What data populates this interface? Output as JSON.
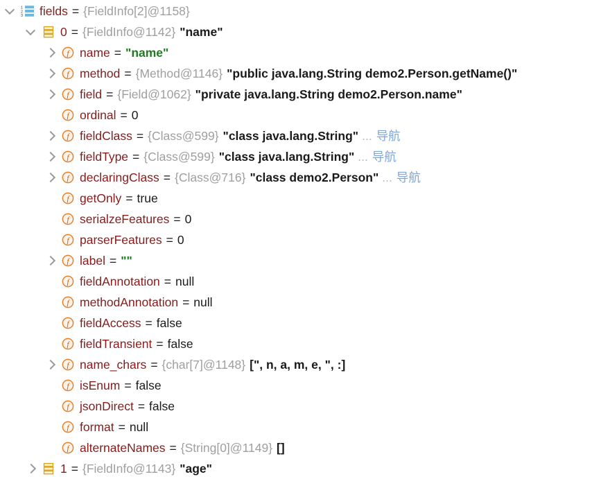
{
  "view": {
    "name": "debugger-variables-tree",
    "background": "#ffffff",
    "colors": {
      "field_name": "#871B1B",
      "type_reference": "#9f9f9f",
      "string_value": "#217C21",
      "plain_value": "#1a1a1a",
      "nav_link": "#7fa8d8",
      "ellipsis": "#b8b8b8",
      "field_icon": "#E8802A",
      "array_icon_blue": "#6BB8DE",
      "array_item_icon": "#D9A01E",
      "twisty": "#9a9a9a"
    }
  },
  "rows": [
    {
      "depth": 0,
      "twisty": "expanded",
      "icon": "array-list-icon",
      "name": "fields",
      "eq": "=",
      "typeref": "{FieldInfo[2]@1158}",
      "value": "",
      "value_kind": "none",
      "ellipsis": "",
      "nav": ""
    },
    {
      "depth": 1,
      "twisty": "expanded",
      "icon": "array-item-icon",
      "name": "0",
      "eq": "=",
      "typeref": "{FieldInfo@1142}",
      "value": "\"name\"",
      "value_kind": "bold",
      "ellipsis": "",
      "nav": ""
    },
    {
      "depth": 2,
      "twisty": "collapsed",
      "icon": "field-icon",
      "name": "name",
      "eq": "=",
      "typeref": "",
      "value": "\"name\"",
      "value_kind": "string",
      "ellipsis": "",
      "nav": ""
    },
    {
      "depth": 2,
      "twisty": "collapsed",
      "icon": "field-icon",
      "name": "method",
      "eq": "=",
      "typeref": "{Method@1146}",
      "value": "\"public java.lang.String demo2.Person.getName()\"",
      "value_kind": "bold",
      "ellipsis": "",
      "nav": ""
    },
    {
      "depth": 2,
      "twisty": "collapsed",
      "icon": "field-icon",
      "name": "field",
      "eq": "=",
      "typeref": "{Field@1062}",
      "value": "\"private java.lang.String demo2.Person.name\"",
      "value_kind": "bold",
      "ellipsis": "",
      "nav": ""
    },
    {
      "depth": 2,
      "twisty": "none",
      "icon": "field-icon",
      "name": "ordinal",
      "eq": "=",
      "typeref": "",
      "value": "0",
      "value_kind": "plain",
      "ellipsis": "",
      "nav": ""
    },
    {
      "depth": 2,
      "twisty": "collapsed",
      "icon": "field-icon",
      "name": "fieldClass",
      "eq": "=",
      "typeref": "{Class@599}",
      "value": "\"class java.lang.String\"",
      "value_kind": "bold",
      "ellipsis": "...",
      "nav": "导航"
    },
    {
      "depth": 2,
      "twisty": "collapsed",
      "icon": "field-icon",
      "name": "fieldType",
      "eq": "=",
      "typeref": "{Class@599}",
      "value": "\"class java.lang.String\"",
      "value_kind": "bold",
      "ellipsis": "...",
      "nav": "导航"
    },
    {
      "depth": 2,
      "twisty": "collapsed",
      "icon": "field-icon",
      "name": "declaringClass",
      "eq": "=",
      "typeref": "{Class@716}",
      "value": "\"class demo2.Person\"",
      "value_kind": "bold",
      "ellipsis": "...",
      "nav": "导航"
    },
    {
      "depth": 2,
      "twisty": "none",
      "icon": "field-icon",
      "name": "getOnly",
      "eq": "=",
      "typeref": "",
      "value": "true",
      "value_kind": "plain",
      "ellipsis": "",
      "nav": ""
    },
    {
      "depth": 2,
      "twisty": "none",
      "icon": "field-icon",
      "name": "serialzeFeatures",
      "eq": "=",
      "typeref": "",
      "value": "0",
      "value_kind": "plain",
      "ellipsis": "",
      "nav": ""
    },
    {
      "depth": 2,
      "twisty": "none",
      "icon": "field-icon",
      "name": "parserFeatures",
      "eq": "=",
      "typeref": "",
      "value": "0",
      "value_kind": "plain",
      "ellipsis": "",
      "nav": ""
    },
    {
      "depth": 2,
      "twisty": "collapsed",
      "icon": "field-icon",
      "name": "label",
      "eq": "=",
      "typeref": "",
      "value": "\"\"",
      "value_kind": "string",
      "ellipsis": "",
      "nav": ""
    },
    {
      "depth": 2,
      "twisty": "none",
      "icon": "field-icon",
      "name": "fieldAnnotation",
      "eq": "=",
      "typeref": "",
      "value": "null",
      "value_kind": "plain",
      "ellipsis": "",
      "nav": ""
    },
    {
      "depth": 2,
      "twisty": "none",
      "icon": "field-icon",
      "name": "methodAnnotation",
      "eq": "=",
      "typeref": "",
      "value": "null",
      "value_kind": "plain",
      "ellipsis": "",
      "nav": ""
    },
    {
      "depth": 2,
      "twisty": "none",
      "icon": "field-icon",
      "name": "fieldAccess",
      "eq": "=",
      "typeref": "",
      "value": "false",
      "value_kind": "plain",
      "ellipsis": "",
      "nav": ""
    },
    {
      "depth": 2,
      "twisty": "none",
      "icon": "field-icon",
      "name": "fieldTransient",
      "eq": "=",
      "typeref": "",
      "value": "false",
      "value_kind": "plain",
      "ellipsis": "",
      "nav": ""
    },
    {
      "depth": 2,
      "twisty": "collapsed",
      "icon": "field-icon",
      "name": "name_chars",
      "eq": "=",
      "typeref": "{char[7]@1148}",
      "value": "[\", n, a, m, e, \", :]",
      "value_kind": "array",
      "ellipsis": "",
      "nav": ""
    },
    {
      "depth": 2,
      "twisty": "none",
      "icon": "field-icon",
      "name": "isEnum",
      "eq": "=",
      "typeref": "",
      "value": "false",
      "value_kind": "plain",
      "ellipsis": "",
      "nav": ""
    },
    {
      "depth": 2,
      "twisty": "none",
      "icon": "field-icon",
      "name": "jsonDirect",
      "eq": "=",
      "typeref": "",
      "value": "false",
      "value_kind": "plain",
      "ellipsis": "",
      "nav": ""
    },
    {
      "depth": 2,
      "twisty": "none",
      "icon": "field-icon",
      "name": "format",
      "eq": "=",
      "typeref": "",
      "value": "null",
      "value_kind": "plain",
      "ellipsis": "",
      "nav": ""
    },
    {
      "depth": 2,
      "twisty": "none",
      "icon": "field-icon",
      "name": "alternateNames",
      "eq": "=",
      "typeref": "{String[0]@1149}",
      "value": "[]",
      "value_kind": "array",
      "ellipsis": "",
      "nav": ""
    },
    {
      "depth": 1,
      "twisty": "collapsed",
      "icon": "array-item-icon",
      "name": "1",
      "eq": "=",
      "typeref": "{FieldInfo@1143}",
      "value": "\"age\"",
      "value_kind": "bold",
      "ellipsis": "",
      "nav": ""
    }
  ]
}
